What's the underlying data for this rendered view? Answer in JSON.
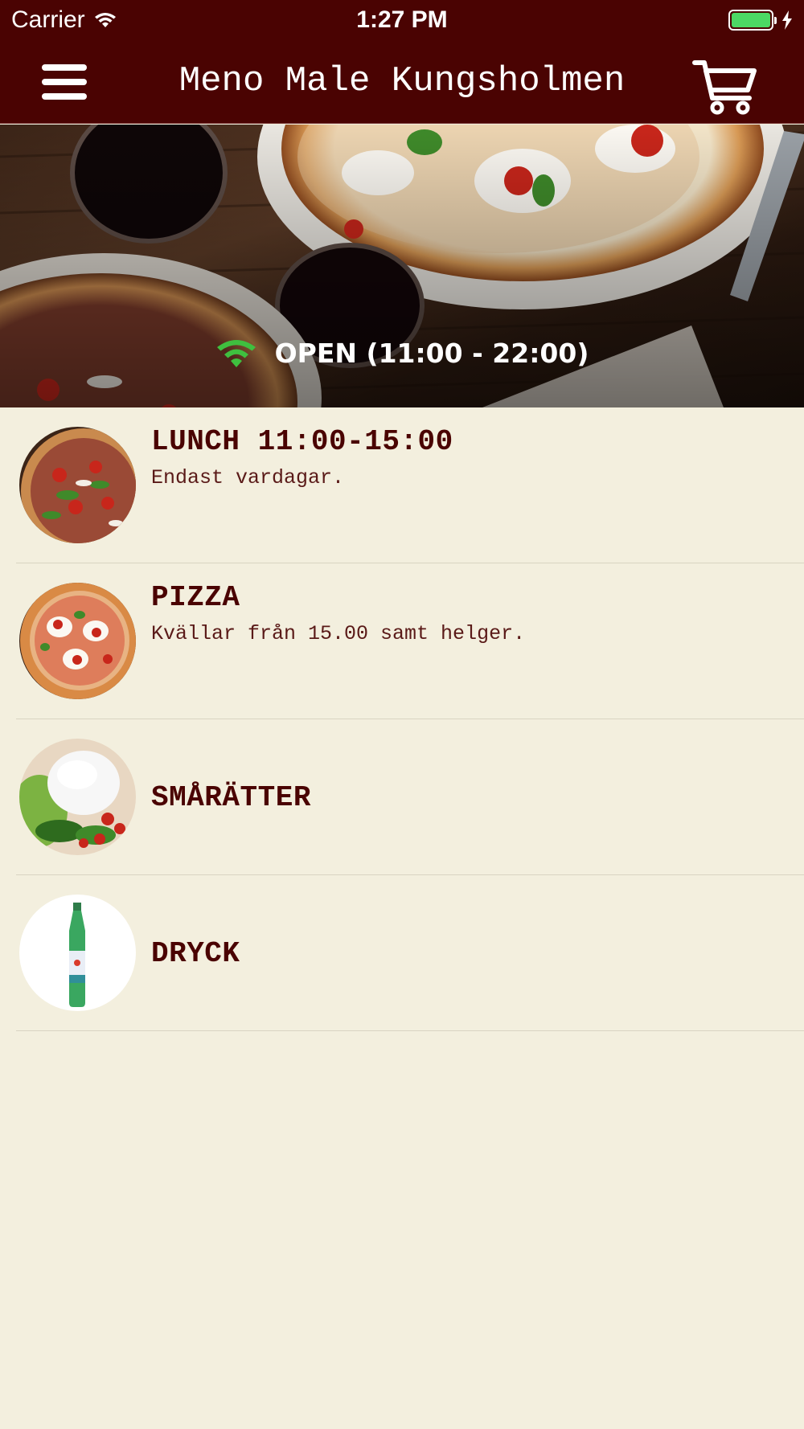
{
  "status_bar": {
    "carrier": "Carrier",
    "time": "1:27 PM",
    "battery_color": "#4cd964"
  },
  "nav": {
    "title": "Meno Male Kungsholmen",
    "menu_icon": "hamburger-menu-icon",
    "cart_icon": "shopping-cart-icon",
    "background": "#4a0302"
  },
  "hero": {
    "status_text": "OPEN (11:00 - 22:00)",
    "status_icon": "wifi-signal-icon",
    "status_icon_color": "#3fbf3f"
  },
  "categories": [
    {
      "title": "LUNCH 11:00-15:00",
      "subtitle": "Endast vardagar.",
      "image": "pizza-with-arugula"
    },
    {
      "title": "PIZZA",
      "subtitle": "Kvällar från 15.00 samt helger.",
      "image": "margherita-pizza"
    },
    {
      "title": "SMÅRÄTTER",
      "subtitle": "",
      "image": "burrata-with-basil"
    },
    {
      "title": "DRYCK",
      "subtitle": "",
      "image": "sparkling-water-bottle"
    }
  ],
  "colors": {
    "accent": "#4a0302",
    "background": "#f3efde"
  }
}
